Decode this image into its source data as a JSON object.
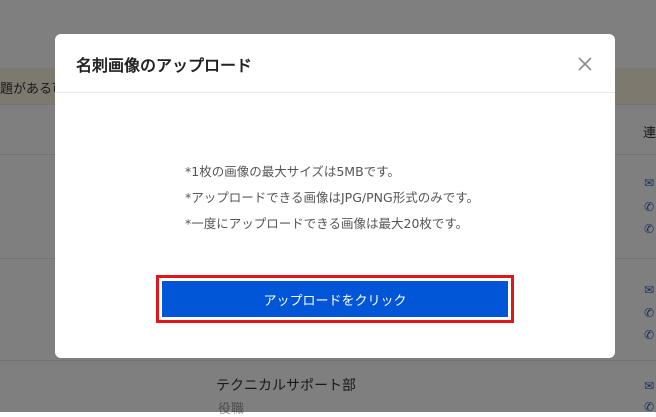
{
  "background": {
    "banner_text": "題がある可",
    "column_header": "連",
    "department": "テクニカルサポート部",
    "sub_label": "役職"
  },
  "modal": {
    "title": "名刺画像のアップロード",
    "notes": [
      "*1枚の画像の最大サイズは5MBです。",
      "*アップロードできる画像はJPG/PNG形式のみです。",
      "*一度にアップロードできる画像は最大20枚です。"
    ],
    "upload_label": "アップロードをクリック"
  },
  "colors": {
    "primary": "#0056d6",
    "highlight_border": "#e0161b",
    "overlay": "rgba(0,0,0,0.5)"
  },
  "icons": [
    "close-icon",
    "mail-icon",
    "phone-icon"
  ]
}
